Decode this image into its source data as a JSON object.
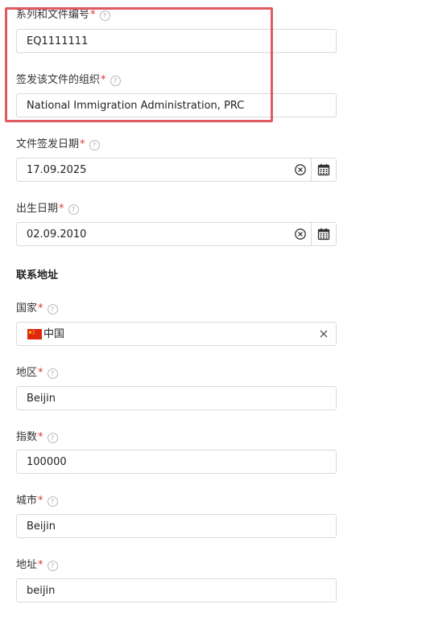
{
  "form": {
    "series_number": {
      "label": "系列和文件编号",
      "required": "*",
      "value": "EQ1111111"
    },
    "issuing_org": {
      "label": "签发该文件的组织",
      "required": "*",
      "value": "National Immigration Administration, PRC"
    },
    "issue_date": {
      "label": "文件签发日期",
      "required": "*",
      "value": "17.09.2025"
    },
    "birth_date": {
      "label": "出生日期",
      "required": "*",
      "value": "02.09.2010"
    },
    "contact_section_title": "联系地址",
    "country": {
      "label": "国家",
      "required": "*",
      "value": "中国",
      "flag": "china-flag"
    },
    "region": {
      "label": "地区",
      "required": "*",
      "value": "Beijin"
    },
    "postal_code": {
      "label": "指数",
      "required": "*",
      "value": "100000"
    },
    "city": {
      "label": "城市",
      "required": "*",
      "value": "Beijin"
    },
    "address": {
      "label": "地址",
      "required": "*",
      "value": "beijin"
    }
  },
  "help_glyph": "?",
  "colors": {
    "highlight": "#e05a5e",
    "required": "#e0303a",
    "border": "#d9d9d9"
  },
  "icons": [
    "help-icon",
    "clear-circle-icon",
    "calendar-icon",
    "close-icon",
    "china-flag-icon"
  ]
}
